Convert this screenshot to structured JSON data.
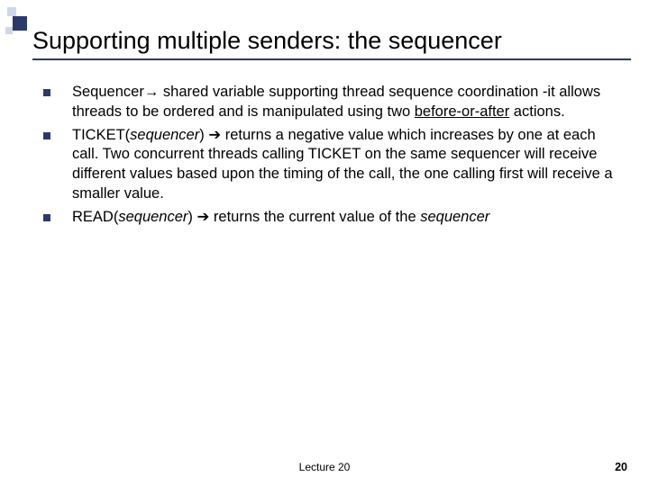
{
  "slide": {
    "title": "Supporting multiple senders: the sequencer",
    "bullets": [
      {
        "lead": "Sequencer",
        "after_lead": " shared variable supporting thread sequence coordination -it allows threads to be ordered and is manipulated using two ",
        "ul_span": "before-or-after",
        "tail": " actions."
      },
      {
        "lead_html": "TICKET(<i>sequencer</i>) ",
        "arrow": "➔",
        "tail": " returns a negative value which increases by one at each call. Two concurrent threads calling TICKET on the same sequencer will  receive different values based upon the timing of the call, the one calling first will receive a smaller value."
      },
      {
        "lead_html": "READ(<i>sequencer</i>) ",
        "arrow": "➔",
        "tail_html": " returns the current value of the <i>sequencer</i>"
      }
    ],
    "footer_center": "Lecture 20",
    "footer_right": "20"
  }
}
